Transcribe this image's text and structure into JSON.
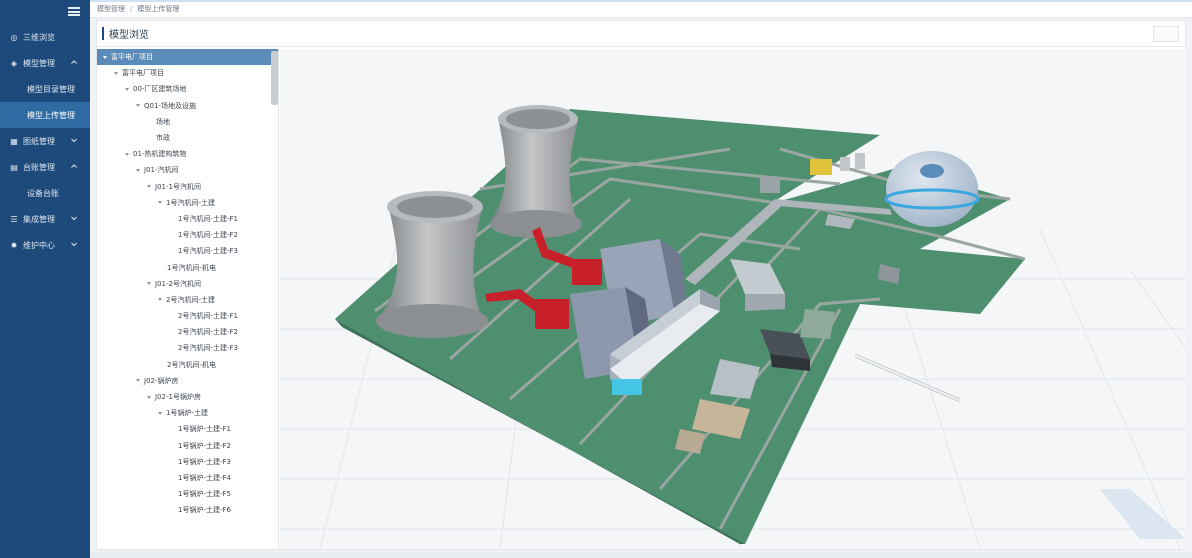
{
  "sidebar": {
    "menu_icon": "hamburger-icon",
    "items": [
      {
        "label": "三维浏览",
        "icon": "globe-icon",
        "expandable": false
      },
      {
        "label": "模型管理",
        "icon": "model-icon",
        "expandable": true,
        "expanded": true
      },
      {
        "label": "模型目录管理",
        "sub": true
      },
      {
        "label": "模型上传管理",
        "sub": true,
        "active": true
      },
      {
        "label": "图纸管理",
        "icon": "drawing-icon",
        "expandable": true
      },
      {
        "label": "台账管理",
        "icon": "ledger-icon",
        "expandable": true,
        "expanded": true
      },
      {
        "label": "设备台账",
        "sub": true
      },
      {
        "label": "集成管理",
        "icon": "database-icon",
        "expandable": true
      },
      {
        "label": "维护中心",
        "icon": "gear-icon",
        "expandable": true
      }
    ]
  },
  "breadcrumb": {
    "items": [
      "模型管理",
      "模型上传管理"
    ],
    "separator": "/"
  },
  "panel": {
    "title": "模型浏览"
  },
  "tree": {
    "rows": [
      {
        "label": "富平电厂项目",
        "level": 0,
        "caret": true,
        "selected": true
      },
      {
        "label": "富平电厂项目",
        "level": 1,
        "caret": true
      },
      {
        "label": "00-厂区建筑场地",
        "level": 2,
        "caret": true
      },
      {
        "label": "Q01-场地及设施",
        "level": 3,
        "caret": true
      },
      {
        "label": "场地",
        "level": 4,
        "caret": false
      },
      {
        "label": "市政",
        "level": 4,
        "caret": false
      },
      {
        "label": "01-热机建构筑物",
        "level": 2,
        "caret": true
      },
      {
        "label": "J01-汽机间",
        "level": 3,
        "caret": true
      },
      {
        "label": "J01-1号汽机间",
        "level": 4,
        "caret": true
      },
      {
        "label": "1号汽机间-土建",
        "level": 5,
        "caret": true
      },
      {
        "label": "1号汽机间-土建-F1",
        "level": 6,
        "caret": false
      },
      {
        "label": "1号汽机间-土建-F2",
        "level": 6,
        "caret": false
      },
      {
        "label": "1号汽机间-土建-F3",
        "level": 6,
        "caret": false
      },
      {
        "label": "1号汽机间-机电",
        "level": 5,
        "caret": false
      },
      {
        "label": "J01-2号汽机间",
        "level": 4,
        "caret": true
      },
      {
        "label": "2号汽机间-土建",
        "level": 5,
        "caret": true
      },
      {
        "label": "2号汽机间-土建-F1",
        "level": 6,
        "caret": false
      },
      {
        "label": "2号汽机间-土建-F2",
        "level": 6,
        "caret": false
      },
      {
        "label": "2号汽机间-土建-F3",
        "level": 6,
        "caret": false
      },
      {
        "label": "2号汽机间-机电",
        "level": 5,
        "caret": false
      },
      {
        "label": "J02-锅炉房",
        "level": 3,
        "caret": true
      },
      {
        "label": "J02-1号锅炉房",
        "level": 4,
        "caret": true
      },
      {
        "label": "1号锅炉-土建",
        "level": 5,
        "caret": true
      },
      {
        "label": "1号锅炉-土建-F1",
        "level": 6,
        "caret": false
      },
      {
        "label": "1号锅炉-土建-F2",
        "level": 6,
        "caret": false
      },
      {
        "label": "1号锅炉-土建-F3",
        "level": 6,
        "caret": false
      },
      {
        "label": "1号锅炉-土建-F4",
        "level": 6,
        "caret": false
      },
      {
        "label": "1号锅炉-土建-F5",
        "level": 6,
        "caret": false
      },
      {
        "label": "1号锅炉-土建-F6",
        "level": 6,
        "caret": false
      }
    ]
  },
  "colors": {
    "sidebar_bg": "#1d4a7a",
    "sidebar_active": "#2f6aa3",
    "tree_selected": "#5b8bb8",
    "ground_green": "#4f8f6f",
    "road_gray": "#8e9a96",
    "tower_gray": "#a6a8aa",
    "duct_red": "#c8202a"
  }
}
